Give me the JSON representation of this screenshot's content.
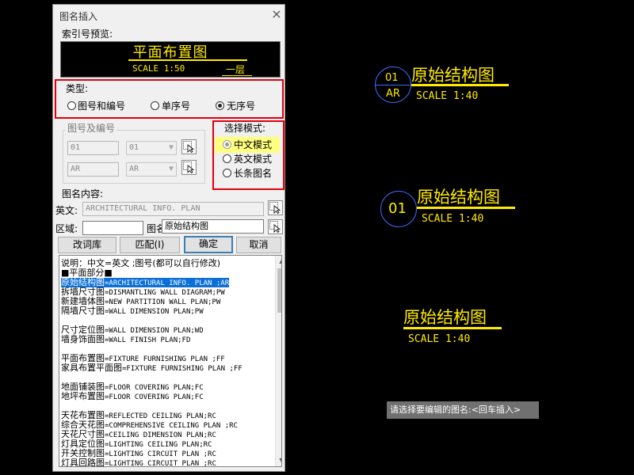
{
  "dialog": {
    "title": "图名插入",
    "close_glyph": "×",
    "preview_label": "索引号预览:",
    "preview": {
      "title": "平面布置图",
      "scale": "SCALE 1:50",
      "floor": "一层"
    },
    "type_label": "类型:",
    "type_options": [
      "图号和编号",
      "单序号",
      "无序号"
    ],
    "type_selected": "无序号",
    "number_label": "图号及编号",
    "number_inputs": {
      "field1": "01",
      "combo1": "01",
      "field2": "AR",
      "combo2": "AR"
    },
    "mode_label": "选择模式:",
    "mode_options": [
      "中文模式",
      "英文模式",
      "长条图名"
    ],
    "mode_selected": "中文模式",
    "content_label": "图名内容:",
    "english_label": "英文:",
    "english_value": "ARCHITECTURAL INFO. PLAN",
    "area_label": "区域:",
    "area_value": "",
    "name_label": "图名:",
    "name_value": "原始结构图",
    "buttons": {
      "edit_lib": "改词库",
      "match": "匹配(I)",
      "ok": "确定",
      "cancel": "取消"
    },
    "list_items": [
      {
        "cn": "说明：中文=英文 ;图号(都可以自行修改)",
        "en": ""
      },
      {
        "cn": "■平面部分■",
        "en": ""
      },
      {
        "cn": "原始结构图",
        "en": "=ARCHITECTURAL INFO. PLAN ;AR",
        "selected": true
      },
      {
        "cn": "拆墙尺寸图",
        "en": "=DISMANTLING WALL DIAGRAM;PW"
      },
      {
        "cn": "新建墙体图",
        "en": "=NEW PARTITION WALL PLAN;PW"
      },
      {
        "cn": "隔墙尺寸图",
        "en": "=WALL DIMENSION PLAN;PW"
      },
      {
        "cn": "",
        "en": ""
      },
      {
        "cn": "尺寸定位图",
        "en": "=WALL DIMENSION PLAN;WD"
      },
      {
        "cn": "墙身饰面图",
        "en": "=WALL FINISH PLAN;FD"
      },
      {
        "cn": "",
        "en": ""
      },
      {
        "cn": "平面布置图",
        "en": "=FIXTURE FURNISHING PLAN  ;FF"
      },
      {
        "cn": "家具布置平面图",
        "en": "=FIXTURE FURNISHING PLAN  ;FF"
      },
      {
        "cn": "",
        "en": ""
      },
      {
        "cn": "地面铺装图",
        "en": "=FLOOR COVERING PLAN;FC"
      },
      {
        "cn": "地坪布置图",
        "en": "=FLOOR COVERING PLAN;FC"
      },
      {
        "cn": "",
        "en": ""
      },
      {
        "cn": "天花布置图",
        "en": "=REFLECTED CEILING PLAN;RC"
      },
      {
        "cn": "综合天花图",
        "en": "=COMPREHENSIVE CEILING PLAN  ;RC"
      },
      {
        "cn": "天花尺寸图",
        "en": "=CEILING DIMENSION PLAN;RC"
      },
      {
        "cn": "灯具定位图",
        "en": "=LIGHTING CEILING PLAN;RC"
      },
      {
        "cn": "开关控制图",
        "en": "=LIGHTING CIRCUIT PLAN  ;RC"
      },
      {
        "cn": "灯具回路图",
        "en": "=LIGHTING CIRCUIT PLAN  ;RC"
      }
    ]
  },
  "canvas": {
    "block1": {
      "num": "01",
      "code": "AR",
      "title": "原始结构图",
      "scale": "SCALE 1:40"
    },
    "block2": {
      "num": "01",
      "title": "原始结构图",
      "scale": "SCALE 1:40"
    },
    "block3": {
      "title": "原始结构图",
      "scale": "SCALE 1:40"
    },
    "command_prompt": "请选择要编辑的图名:<回车插入>"
  },
  "colors": {
    "canvas_bg": "#000000",
    "annotation": "#ffea00",
    "bubble": "#3a6cff",
    "selection": "#0a6fd8",
    "highlight_box": "#e0000f"
  }
}
